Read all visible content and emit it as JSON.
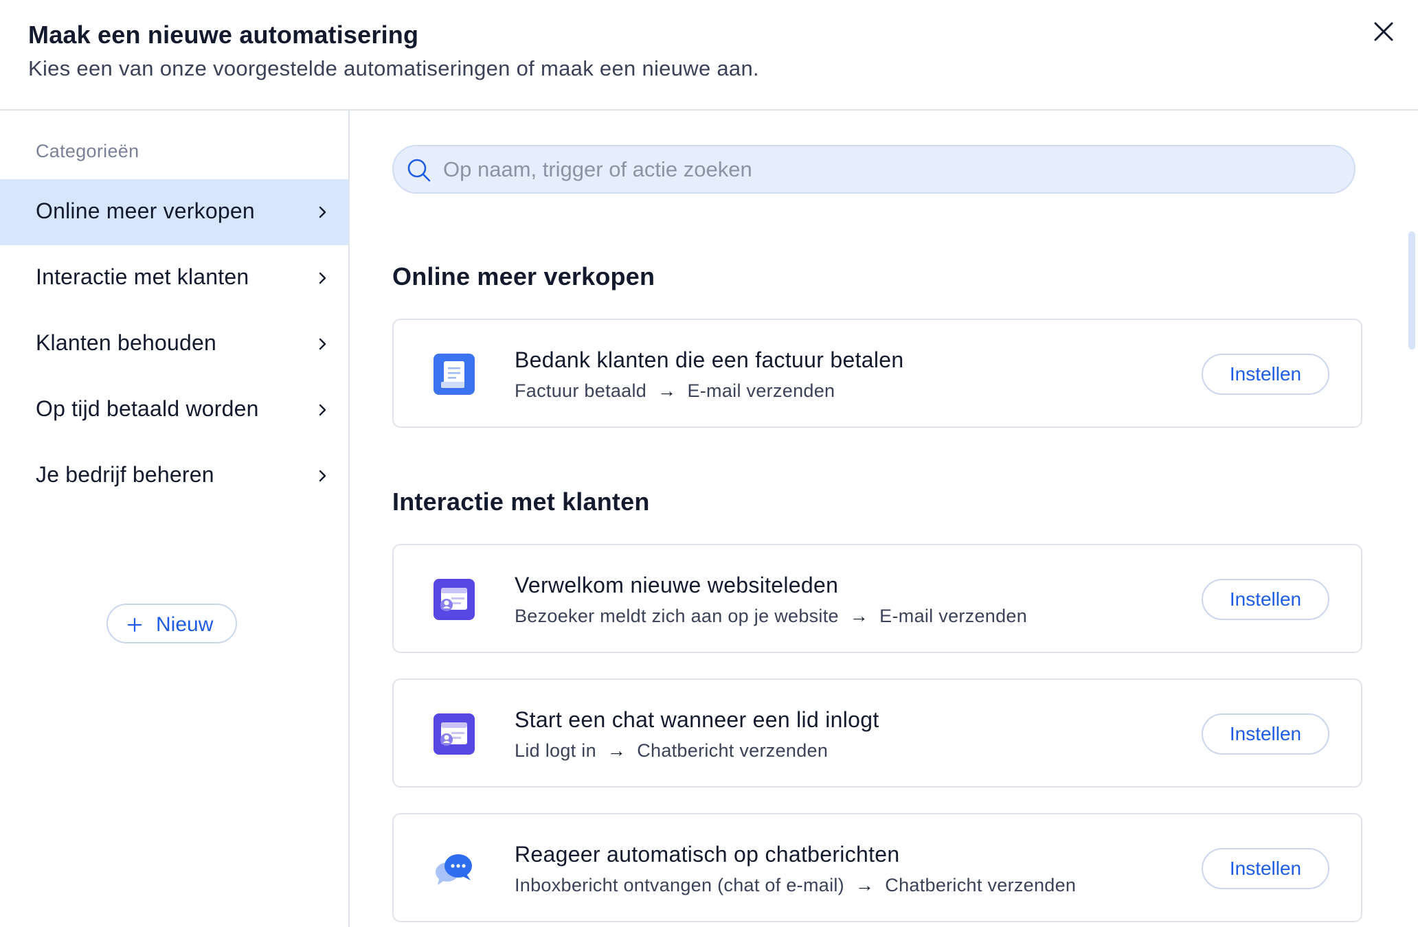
{
  "header": {
    "title": "Maak een nieuwe automatisering",
    "subtitle": "Kies een van onze voorgestelde automatiseringen of maak een nieuwe aan.",
    "close_icon": "close-icon"
  },
  "sidebar": {
    "heading": "Categorieën",
    "items": [
      {
        "label": "Online meer verkopen",
        "active": true
      },
      {
        "label": "Interactie met klanten",
        "active": false
      },
      {
        "label": "Klanten behouden",
        "active": false
      },
      {
        "label": "Op tijd betaald worden",
        "active": false
      },
      {
        "label": "Je bedrijf beheren",
        "active": false
      }
    ],
    "new_button": "Nieuw"
  },
  "search": {
    "placeholder": "Op naam, trigger of actie zoeken",
    "value": ""
  },
  "sections": [
    {
      "title": "Online meer verkopen",
      "cards": [
        {
          "icon": "invoice-icon",
          "title": "Bedank klanten die een factuur betalen",
          "trigger": "Factuur betaald",
          "action": "E-mail verzenden",
          "button": "Instellen"
        }
      ]
    },
    {
      "title": "Interactie met klanten",
      "cards": [
        {
          "icon": "member-signup-icon",
          "title": "Verwelkom nieuwe websiteleden",
          "trigger": "Bezoeker meldt zich aan op je website",
          "action": "E-mail verzenden",
          "button": "Instellen"
        },
        {
          "icon": "member-login-icon",
          "title": "Start een chat wanneer een lid inlogt",
          "trigger": "Lid logt in",
          "action": "Chatbericht verzenden",
          "button": "Instellen"
        },
        {
          "icon": "chat-bubbles-icon",
          "title": "Reageer automatisch op chatberichten",
          "trigger": "Inboxbericht ontvangen (chat of e-mail)",
          "action": "Chatbericht verzenden",
          "button": "Instellen"
        }
      ]
    }
  ],
  "arrow_glyph": "→",
  "colors": {
    "accent": "#1e5ce6",
    "active_bg": "#d8e6fd",
    "search_bg": "#e6eefc",
    "invoice_icon": "#3b73f0",
    "member_icon": "#5748e4"
  }
}
